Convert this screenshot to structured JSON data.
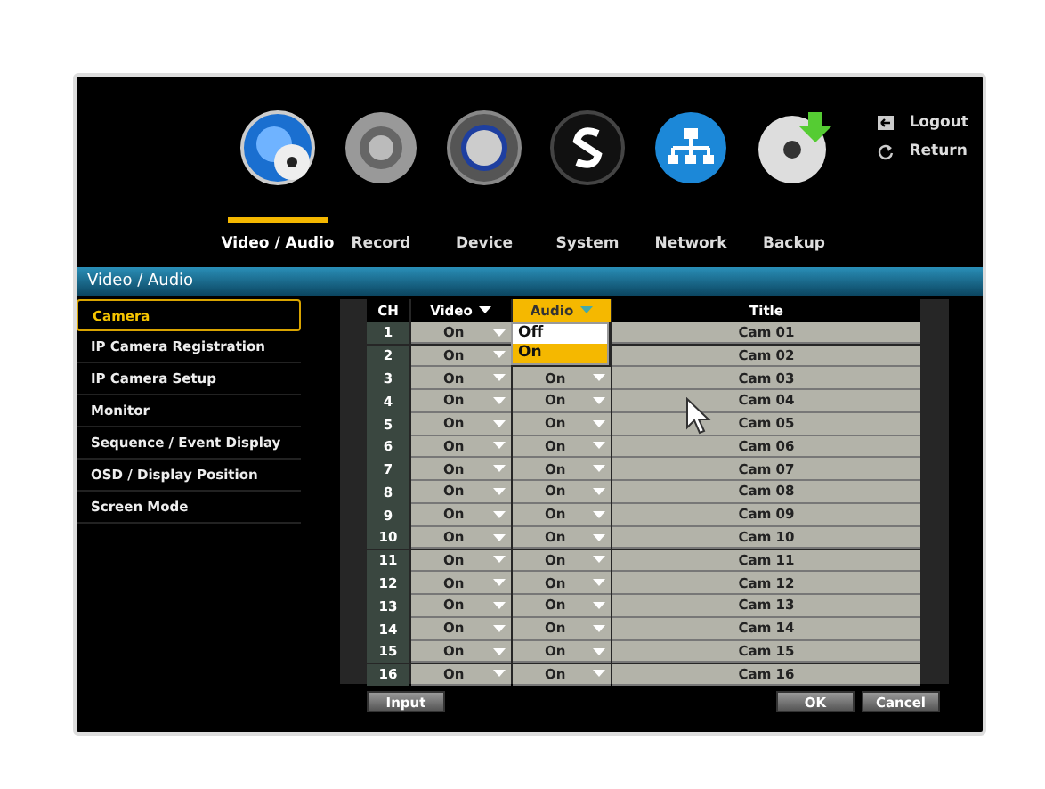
{
  "nav": {
    "tabs": [
      {
        "label": "Video / Audio",
        "selected": true
      },
      {
        "label": "Record",
        "selected": false
      },
      {
        "label": "Device",
        "selected": false
      },
      {
        "label": "System",
        "selected": false
      },
      {
        "label": "Network",
        "selected": false
      },
      {
        "label": "Backup",
        "selected": false
      }
    ],
    "links": [
      {
        "label": "Logout",
        "kind": "logout"
      },
      {
        "label": "Return",
        "kind": "return"
      }
    ]
  },
  "section_title": "Video / Audio",
  "sidebar": {
    "items": [
      {
        "label": "Camera",
        "selected": true
      },
      {
        "label": "IP Camera Registration",
        "selected": false
      },
      {
        "label": "IP Camera Setup",
        "selected": false
      },
      {
        "label": "Monitor",
        "selected": false
      },
      {
        "label": "Sequence / Event Display",
        "selected": false
      },
      {
        "label": "OSD / Display Position",
        "selected": false
      },
      {
        "label": "Screen Mode",
        "selected": false
      }
    ]
  },
  "table": {
    "columns": [
      {
        "label": "CH",
        "dropdown": false,
        "active": false
      },
      {
        "label": "Video",
        "dropdown": true,
        "active": false
      },
      {
        "label": "Audio",
        "dropdown": true,
        "active": true
      },
      {
        "label": "Title",
        "dropdown": false,
        "active": false
      }
    ],
    "rows": [
      {
        "ch": "1",
        "video": "On",
        "title": "Cam 01"
      },
      {
        "ch": "2",
        "video": "On",
        "title": "Cam 02"
      },
      {
        "ch": "3",
        "video": "On",
        "audio": "On",
        "title": "Cam 03"
      },
      {
        "ch": "4",
        "video": "On",
        "audio": "On",
        "title": "Cam 04"
      },
      {
        "ch": "5",
        "video": "On",
        "audio": "On",
        "title": "Cam 05"
      },
      {
        "ch": "6",
        "video": "On",
        "audio": "On",
        "title": "Cam 06"
      },
      {
        "ch": "7",
        "video": "On",
        "audio": "On",
        "title": "Cam 07"
      },
      {
        "ch": "8",
        "video": "On",
        "audio": "On",
        "title": "Cam 08"
      },
      {
        "ch": "9",
        "video": "On",
        "audio": "On",
        "title": "Cam 09"
      },
      {
        "ch": "10",
        "video": "On",
        "audio": "On",
        "title": "Cam 10"
      },
      {
        "ch": "11",
        "video": "On",
        "audio": "On",
        "title": "Cam 11"
      },
      {
        "ch": "12",
        "video": "On",
        "audio": "On",
        "title": "Cam 12"
      },
      {
        "ch": "13",
        "video": "On",
        "audio": "On",
        "title": "Cam 13"
      },
      {
        "ch": "14",
        "video": "On",
        "audio": "On",
        "title": "Cam 14"
      },
      {
        "ch": "15",
        "video": "On",
        "audio": "On",
        "title": "Cam 15"
      },
      {
        "ch": "16",
        "video": "On",
        "audio": "On",
        "title": "Cam 16"
      }
    ],
    "dropdown": {
      "options": [
        {
          "label": "Off",
          "selected": false
        },
        {
          "label": "On",
          "selected": true
        }
      ]
    }
  },
  "buttons": {
    "left": [
      "Input"
    ],
    "right": [
      "OK",
      "Cancel"
    ]
  }
}
